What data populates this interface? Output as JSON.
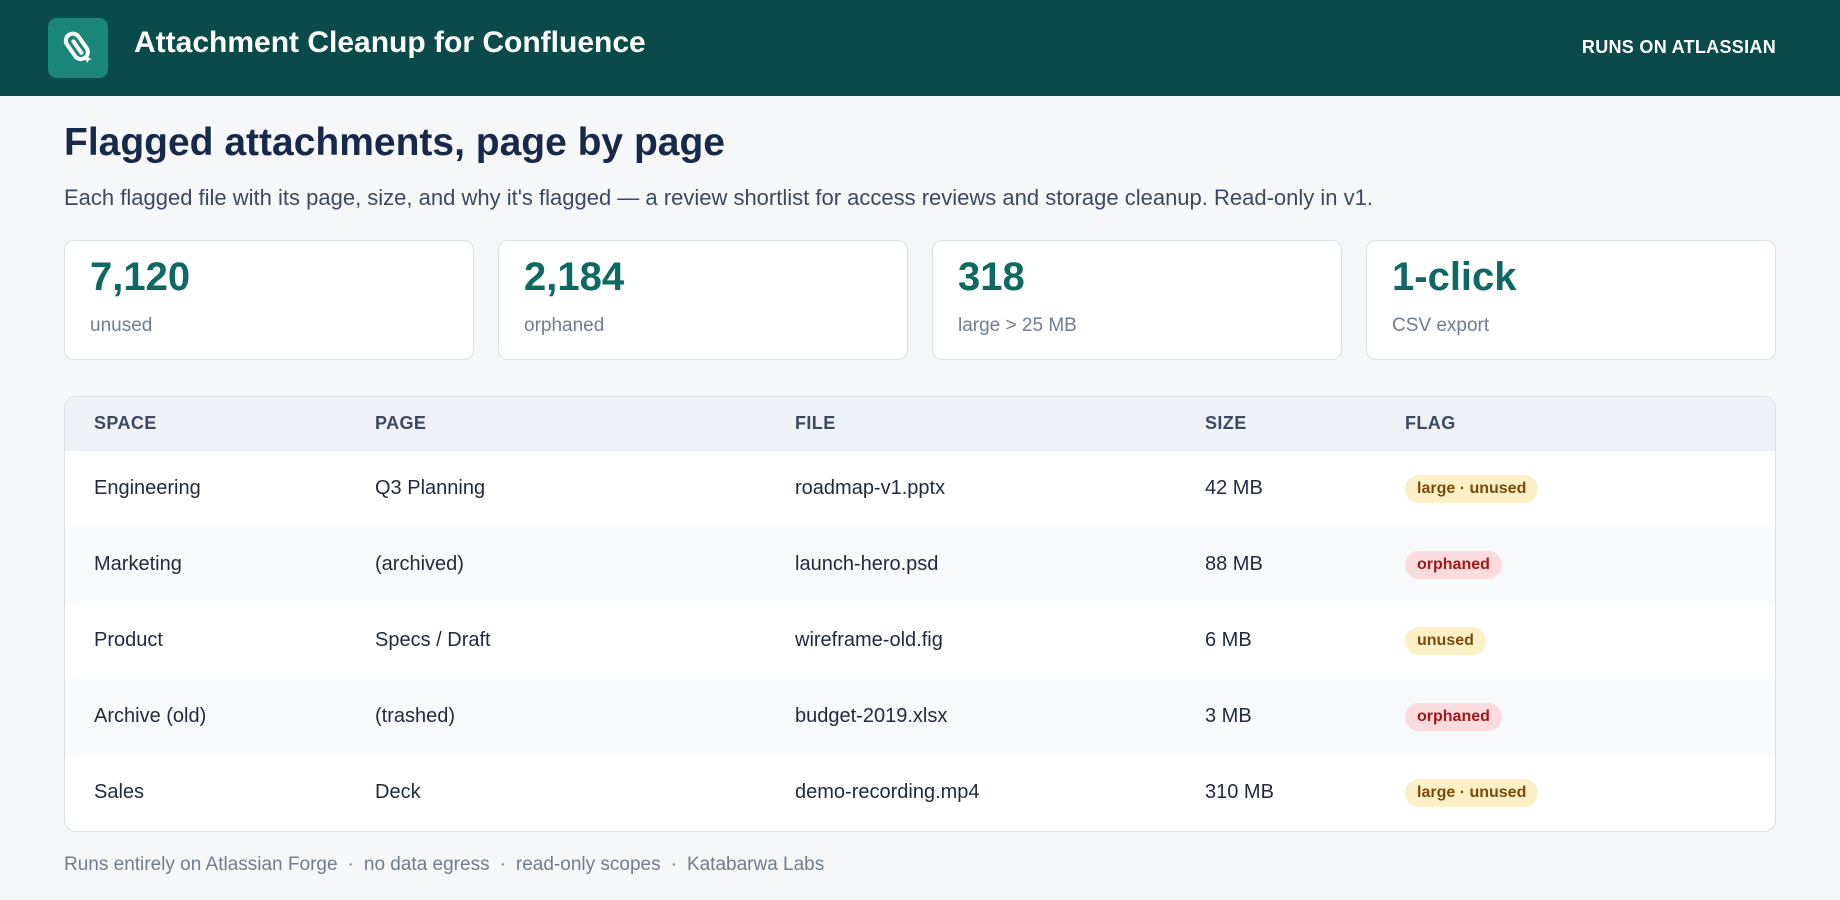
{
  "header": {
    "app_title": "Attachment Cleanup for Confluence",
    "badge": "RUNS ON ATLASSIAN",
    "logo_icon": "paperclip-icon"
  },
  "main": {
    "title": "Flagged attachments, page by page",
    "subtitle": "Each flagged file with its page, size, and why it's flagged — a review shortlist for access reviews and storage cleanup. Read-only in v1."
  },
  "stats": [
    {
      "value": "7,120",
      "label": "unused"
    },
    {
      "value": "2,184",
      "label": "orphaned"
    },
    {
      "value": "318",
      "label": "large > 25 MB"
    },
    {
      "value": "1-click",
      "label": "CSV export"
    }
  ],
  "table": {
    "headers": {
      "space": "SPACE",
      "page": "PAGE",
      "file": "FILE",
      "size": "SIZE",
      "flag": "FLAG"
    },
    "rows": [
      {
        "space": "Engineering",
        "page": "Q3 Planning",
        "file": "roadmap-v1.pptx",
        "size": "42 MB",
        "flag": "large · unused"
      },
      {
        "space": "Marketing",
        "page": "(archived)",
        "file": "launch-hero.psd",
        "size": "88 MB",
        "flag": "orphaned"
      },
      {
        "space": "Product",
        "page": "Specs / Draft",
        "file": "wireframe-old.fig",
        "size": "6 MB",
        "flag": "unused"
      },
      {
        "space": "Archive (old)",
        "page": "(trashed)",
        "file": "budget-2019.xlsx",
        "size": "3 MB",
        "flag": "orphaned"
      },
      {
        "space": "Sales",
        "page": "Deck",
        "file": "demo-recording.mp4",
        "size": "310 MB",
        "flag": "large · unused"
      }
    ]
  },
  "footer": {
    "items": [
      "Runs entirely on Atlassian Forge",
      "no data egress",
      "read-only scopes",
      "Katabarwa Labs"
    ],
    "separator": "·"
  },
  "colors": {
    "topbar": "#0b4a4a",
    "logo_bg": "#1a8579",
    "accent": "#0e6961",
    "warn_bg": "#fdefc6",
    "warn_text": "#7a4a08",
    "danger_bg": "#fbdcdc",
    "danger_text": "#a3161c"
  }
}
